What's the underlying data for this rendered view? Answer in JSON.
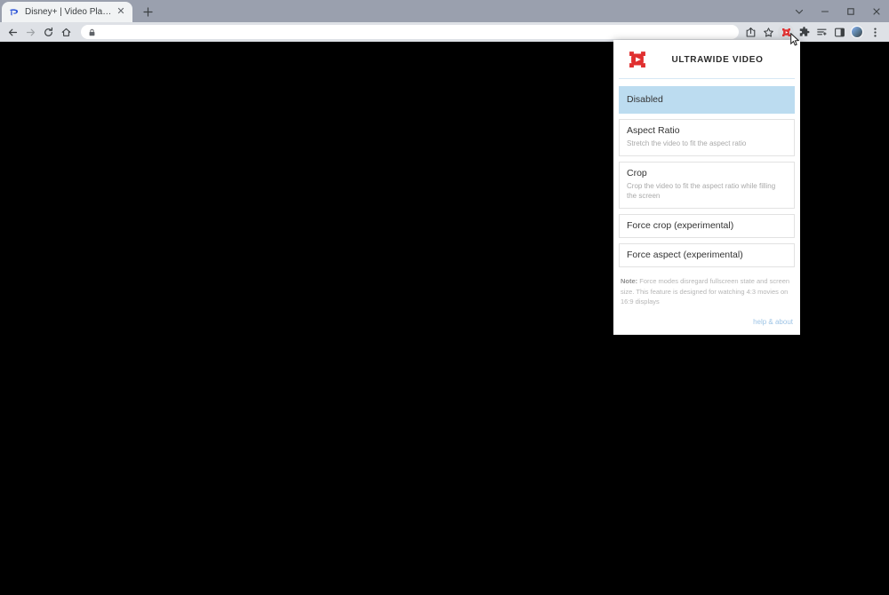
{
  "window": {
    "controls": [
      {
        "name": "tab-search",
        "glyph": "⌄"
      },
      {
        "name": "minimize",
        "glyph": "−"
      },
      {
        "name": "maximize",
        "glyph": "□"
      },
      {
        "name": "close",
        "glyph": "✕"
      }
    ]
  },
  "tabs": [
    {
      "title": "Disney+ | Video Player",
      "favicon": "disney-plus-icon",
      "close_glyph": "✕",
      "active": true
    }
  ],
  "new_tab": {
    "label": "+",
    "icon": "plus-icon"
  },
  "toolbar": {
    "back": {
      "icon": "back-arrow-icon",
      "glyph": "←",
      "enabled": true
    },
    "forward": {
      "icon": "forward-arrow-icon",
      "glyph": "→",
      "enabled": false
    },
    "reload": {
      "icon": "reload-icon",
      "glyph": "↻",
      "enabled": true
    },
    "home": {
      "icon": "home-icon",
      "glyph": "⌂",
      "enabled": true
    },
    "omnibox": {
      "value": "",
      "placeholder": "",
      "lock_icon": "lock-icon"
    },
    "share": {
      "icon": "share-icon"
    },
    "bookmark": {
      "icon": "star-icon"
    },
    "extension_ultrawide": {
      "icon": "ultrawide-video-extension-icon",
      "active": true
    },
    "extensions": {
      "icon": "puzzle-piece-icon"
    },
    "reading_list": {
      "icon": "reading-list-icon"
    },
    "side_panel": {
      "icon": "side-panel-icon"
    },
    "profile": {
      "icon": "avatar-icon"
    },
    "menu": {
      "icon": "three-dot-menu-icon",
      "glyph": "⋮"
    }
  },
  "popup": {
    "logo": "ultrawide-video-logo",
    "title": "ULTRAWIDE VIDEO",
    "options": [
      {
        "label": "Disabled",
        "description": "",
        "selected": true
      },
      {
        "label": "Aspect Ratio",
        "description": "Stretch the video to fit the aspect ratio",
        "selected": false
      },
      {
        "label": "Crop",
        "description": "Crop the video to fit the aspect ratio while filling the screen",
        "selected": false
      },
      {
        "label": "Force crop (experimental)",
        "description": "",
        "selected": false
      },
      {
        "label": "Force aspect (experimental)",
        "description": "",
        "selected": false
      }
    ],
    "note_prefix": "Note:",
    "note_text": " Force modes disregard fullscreen state and screen size. This feature is designed for watching 4:3 movies on 16:9 displays",
    "footer_link": "help & about"
  },
  "colors": {
    "accent_red": "#e03030",
    "selected_blue": "#bcdcf0",
    "link_blue": "#9ec4e6",
    "tabstrip": "#9aa0ae",
    "toolbar": "#dee1e6",
    "page_background": "#000000"
  }
}
